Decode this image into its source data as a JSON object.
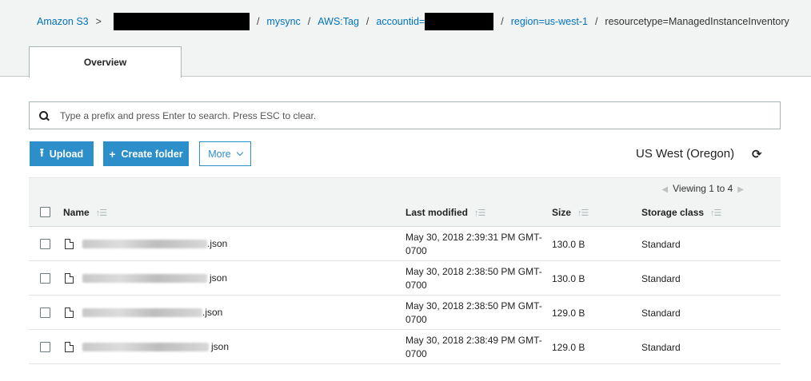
{
  "breadcrumb": {
    "root": "Amazon S3",
    "separator": "/",
    "first_separator": ">",
    "items": [
      "mysync",
      "AWS:Tag",
      "accountid=",
      "region=us-west-1"
    ],
    "current": "resourcetype=ManagedInstanceInventory"
  },
  "tabs": {
    "overview": "Overview"
  },
  "search": {
    "placeholder": "Type a prefix and press Enter to search. Press ESC to clear."
  },
  "toolbar": {
    "upload_label": "Upload",
    "create_folder_label": "Create folder",
    "more_label": "More",
    "region": "US West (Oregon)"
  },
  "pagination": {
    "viewing": "Viewing 1 to 4"
  },
  "table": {
    "columns": {
      "name": "Name",
      "modified": "Last modified",
      "size": "Size",
      "storage": "Storage class"
    },
    "rows": [
      {
        "name_suffix": ".json",
        "modified_line1": "May 30, 2018 2:39:31 PM GMT-",
        "modified_line2": "0700",
        "size": "130.0 B",
        "storage": "Standard"
      },
      {
        "name_suffix": "json",
        "modified_line1": "May 30, 2018 2:38:50 PM GMT-",
        "modified_line2": "0700",
        "size": "130.0 B",
        "storage": "Standard"
      },
      {
        "name_suffix": ".json",
        "modified_line1": "May 30, 2018 2:38:50 PM GMT-",
        "modified_line2": "0700",
        "size": "129.0 B",
        "storage": "Standard"
      },
      {
        "name_suffix": "json",
        "modified_line1": "May 30, 2018 2:38:49 PM GMT-",
        "modified_line2": "0700",
        "size": "129.0 B",
        "storage": "Standard"
      }
    ]
  },
  "icons": {
    "search": "search-icon",
    "upload": "upload-icon",
    "create_folder": "plus-icon",
    "more": "chevron-down-icon",
    "refresh": "refresh-icon",
    "sort": "sort-icon",
    "file": "file-icon"
  },
  "colors": {
    "link": "#0073bb",
    "primary_button": "#2d8fc9",
    "header_bg": "#f2f3f3"
  }
}
